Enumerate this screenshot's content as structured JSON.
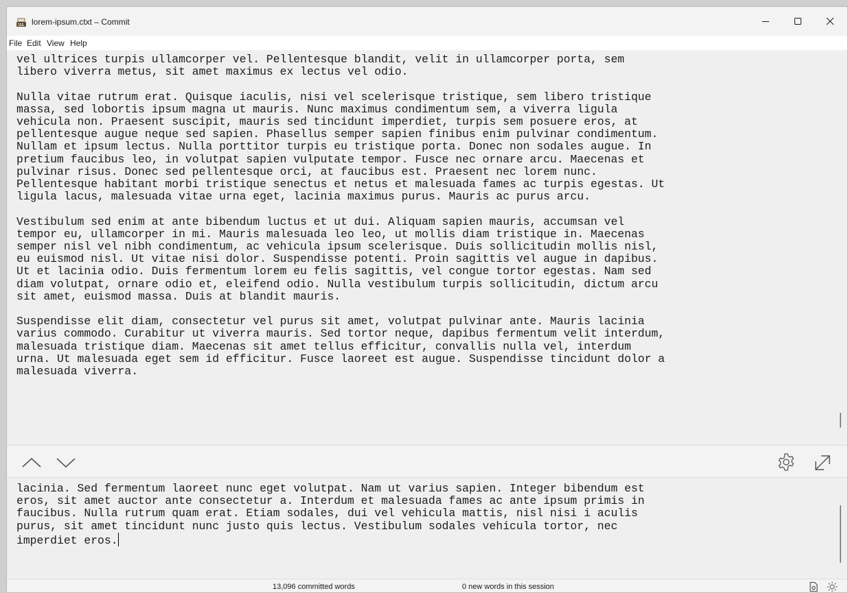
{
  "window": {
    "title": "lorem-ipsum.ctxt – Commit",
    "icons": {
      "app": "typewriter-icon",
      "minimize": "minimize-icon",
      "maximize": "maximize-icon",
      "close": "close-icon"
    }
  },
  "menu": {
    "file": "File",
    "edit": "Edit",
    "view": "View",
    "help": "Help"
  },
  "committed_text": "vel ultrices turpis ullamcorper vel. Pellentesque blandit, velit in ullamcorper porta, sem\nlibero viverra metus, sit amet maximus ex lectus vel odio.\n\nNulla vitae rutrum erat. Quisque iaculis, nisi vel scelerisque tristique, sem libero tristique\nmassa, sed lobortis ipsum magna ut mauris. Nunc maximus condimentum sem, a viverra ligula\nvehicula non. Praesent suscipit, mauris sed tincidunt imperdiet, turpis sem posuere eros, at\npellentesque augue neque sed sapien. Phasellus semper sapien finibus enim pulvinar condimentum.\nNullam et ipsum lectus. Nulla porttitor turpis eu tristique porta. Donec non sodales augue. In\npretium faucibus leo, in volutpat sapien vulputate tempor. Fusce nec ornare arcu. Maecenas et\npulvinar risus. Donec sed pellentesque orci, at faucibus est. Praesent nec lorem nunc.\nPellentesque habitant morbi tristique senectus et netus et malesuada fames ac turpis egestas. Ut\nligula lacus, malesuada vitae urna eget, lacinia maximus purus. Mauris ac purus arcu.\n\nVestibulum sed enim at ante bibendum luctus et ut dui. Aliquam sapien mauris, accumsan vel\ntempor eu, ullamcorper in mi. Mauris malesuada leo leo, ut mollis diam tristique in. Maecenas\nsemper nisl vel nibh condimentum, ac vehicula ipsum scelerisque. Duis sollicitudin mollis nisl,\neu euismod nisl. Ut vitae nisi dolor. Suspendisse potenti. Proin sagittis vel augue in dapibus.\nUt et lacinia odio. Duis fermentum lorem eu felis sagittis, vel congue tortor egestas. Nam sed\ndiam volutpat, ornare odio et, eleifend odio. Nulla vestibulum turpis sollicitudin, dictum arcu\nsit amet, euismod massa. Duis at blandit mauris.\n\nSuspendisse elit diam, consectetur vel purus sit amet, volutpat pulvinar ante. Mauris lacinia\nvarius commodo. Curabitur ut viverra mauris. Sed tortor neque, dapibus fermentum velit interdum,\nmalesuada tristique diam. Maecenas sit amet tellus efficitur, convallis nulla vel, interdum\nurna. Ut malesuada eget sem id efficitur. Fusce laoreet est augue. Suspendisse tincidunt dolor a\nmalesuada viverra.",
  "toolbar": {
    "icons": {
      "up": "chevron-up-icon",
      "down": "chevron-down-icon",
      "settings": "gear-icon",
      "expand": "expand-icon"
    }
  },
  "editor_text": "lacinia. Sed fermentum laoreet nunc eget volutpat. Nam ut varius sapien. Integer bibendum est\neros, sit amet auctor ante consectetur a. Interdum et malesuada fames ac ante ipsum primis in\nfaucibus. Nulla rutrum quam erat. Etiam sodales, dui vel vehicula mattis, nisl nisi i aculis\npurus, sit amet tincidunt nunc justo quis lectus. Vestibulum sodales vehicula tortor, nec\nimperdiet eros.",
  "status": {
    "committed_words": "13,096 committed words",
    "session_words": "0 new words in this session",
    "icons": {
      "document": "document-icon",
      "theme": "sun-icon"
    }
  },
  "colors": {
    "background": "#efefef",
    "text": "#1c1c1c",
    "chrome": "#f3f3f3"
  }
}
